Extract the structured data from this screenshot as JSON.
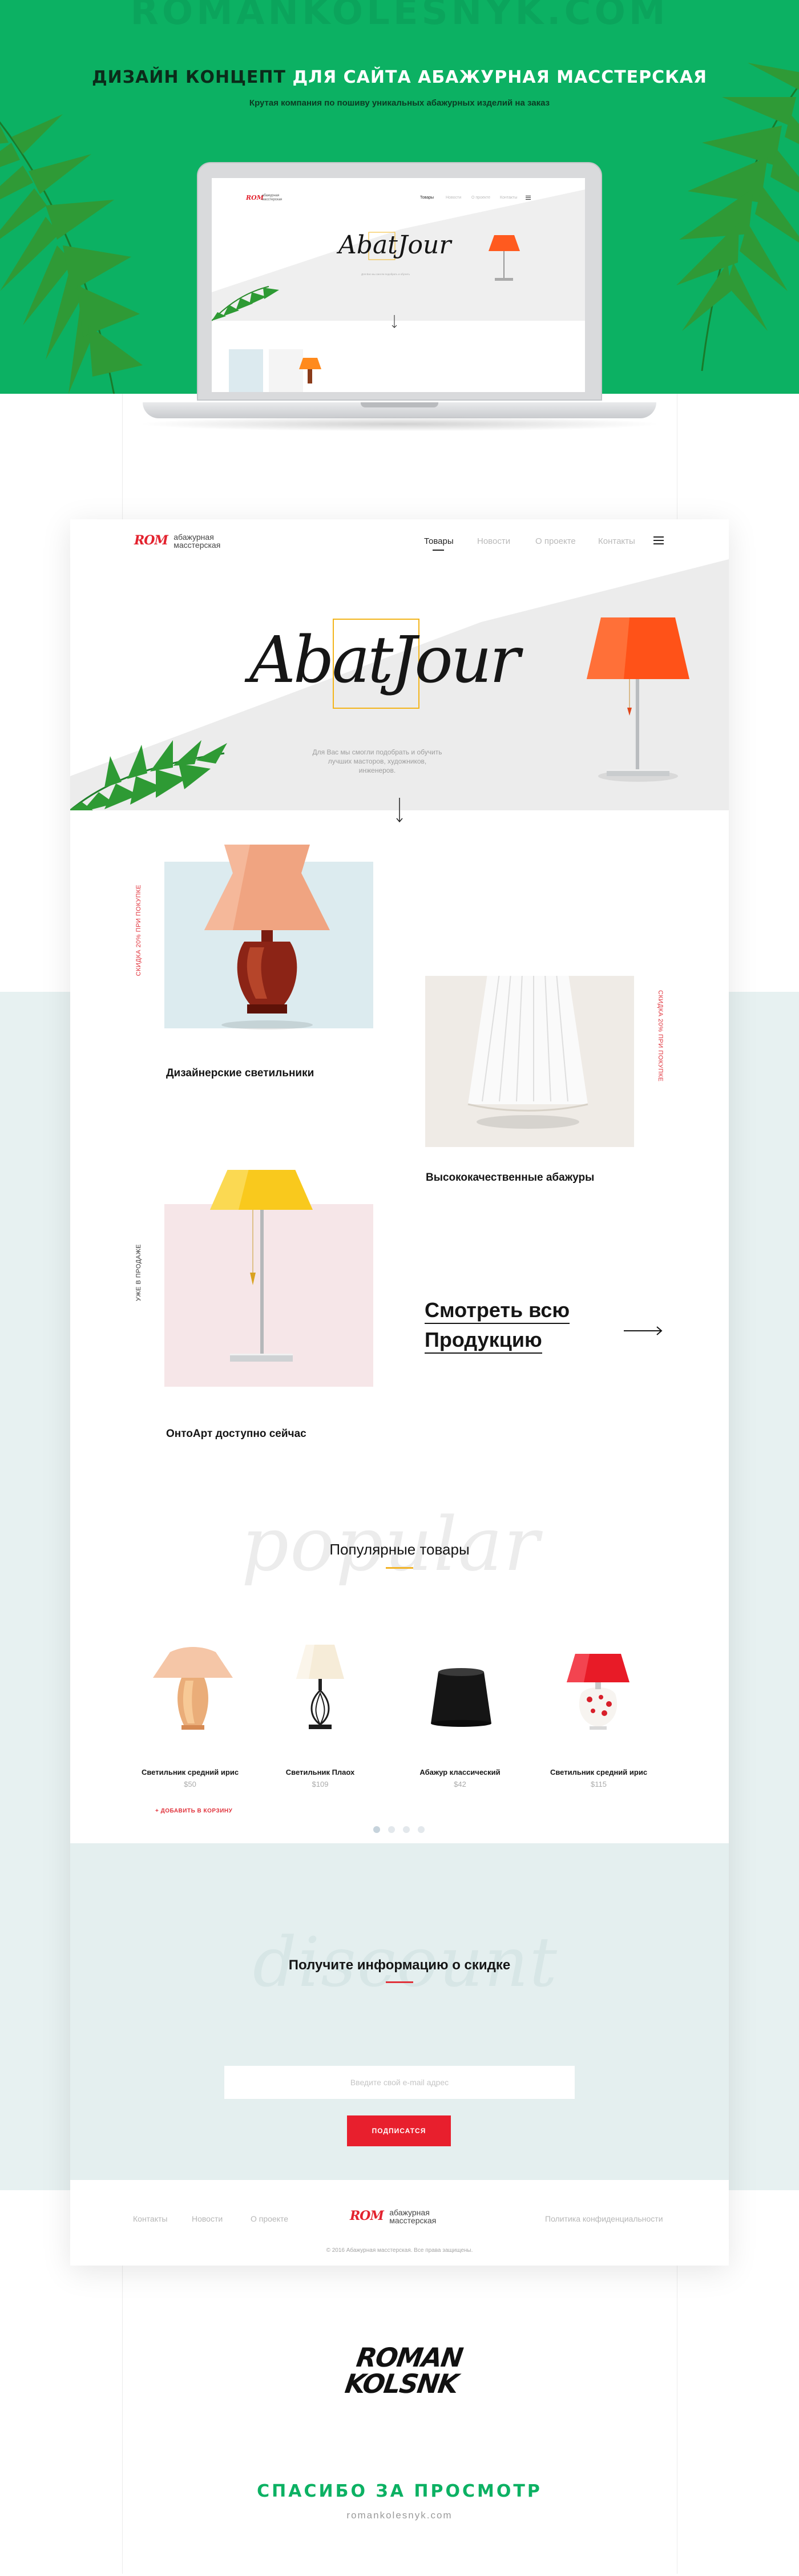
{
  "hero": {
    "watermark": "ROMANKOLESNYK.COM",
    "title_part1": "ДИЗАЙН КОНЦЕПТ ",
    "title_part2": "ДЛЯ САЙТА АБАЖУРНАЯ МАССТЕРСКАЯ",
    "subtitle": "Крутая компания по пошиву уникальных абажурных изделий на заказ"
  },
  "brand": {
    "logo_mark": "ROM",
    "logo_line1": "абажурная",
    "logo_line2": "масстерская"
  },
  "nav": {
    "items": [
      "Товары",
      "Новости",
      "О проекте",
      "Контакты"
    ],
    "active": "Товары"
  },
  "intro": {
    "script": "AbatJour",
    "text": "Для Вас мы смогли подобрать и обучить лучших масторов, художников, инженеров."
  },
  "categories": [
    {
      "title": "Дизайнерские светильники",
      "side_label": "СКИДКА 20% ПРИ ПОКУПКЕ"
    },
    {
      "title": "Высококачественные абажуры",
      "side_label": "СКИДКА 20% ПРИ ПОКУПКЕ"
    },
    {
      "title": "ОнтоАрт доступно сейчас",
      "side_label": "УЖЕ В ПРОДАЖЕ"
    }
  ],
  "view_all": {
    "line1": "Смотреть всю",
    "line2": "Продукцию"
  },
  "popular": {
    "bg_script": "popular",
    "title": "Популярные товары",
    "add_to_cart": "+ ДОБАВИТЬ В КОРЗИНУ",
    "products": [
      {
        "name": "Светильник средний ирис",
        "price": "$50"
      },
      {
        "name": "Светильник Плаох",
        "price": "$109"
      },
      {
        "name": "Абажур классический",
        "price": "$42"
      },
      {
        "name": "Светильник средний ирис",
        "price": "$115"
      }
    ],
    "pagination_count": 4,
    "pagination_active": 1
  },
  "subscribe": {
    "bg_script": "discount",
    "title": "Получите информацию о скидке",
    "placeholder": "Введите свой e-mail адрес",
    "button": "ПОДПИСАТСЯ"
  },
  "footer": {
    "links_left": [
      "Контакты",
      "Новости",
      "О проекте"
    ],
    "link_right": "Политика конфиденциальности",
    "copyright": "© 2016 Абажурная масстерская. Все права защищены."
  },
  "closing": {
    "signature_line1": "ROMAN",
    "signature_line2": "KOLSNK",
    "thanks": "СПАСИБО ЗА ПРОСМОТР",
    "site": "romankolesnyk.com"
  },
  "colors": {
    "hero_green": "#0cb163",
    "accent_red": "#e81f2d",
    "accent_yellow": "#f2b326",
    "mint_band": "#e4efef"
  }
}
